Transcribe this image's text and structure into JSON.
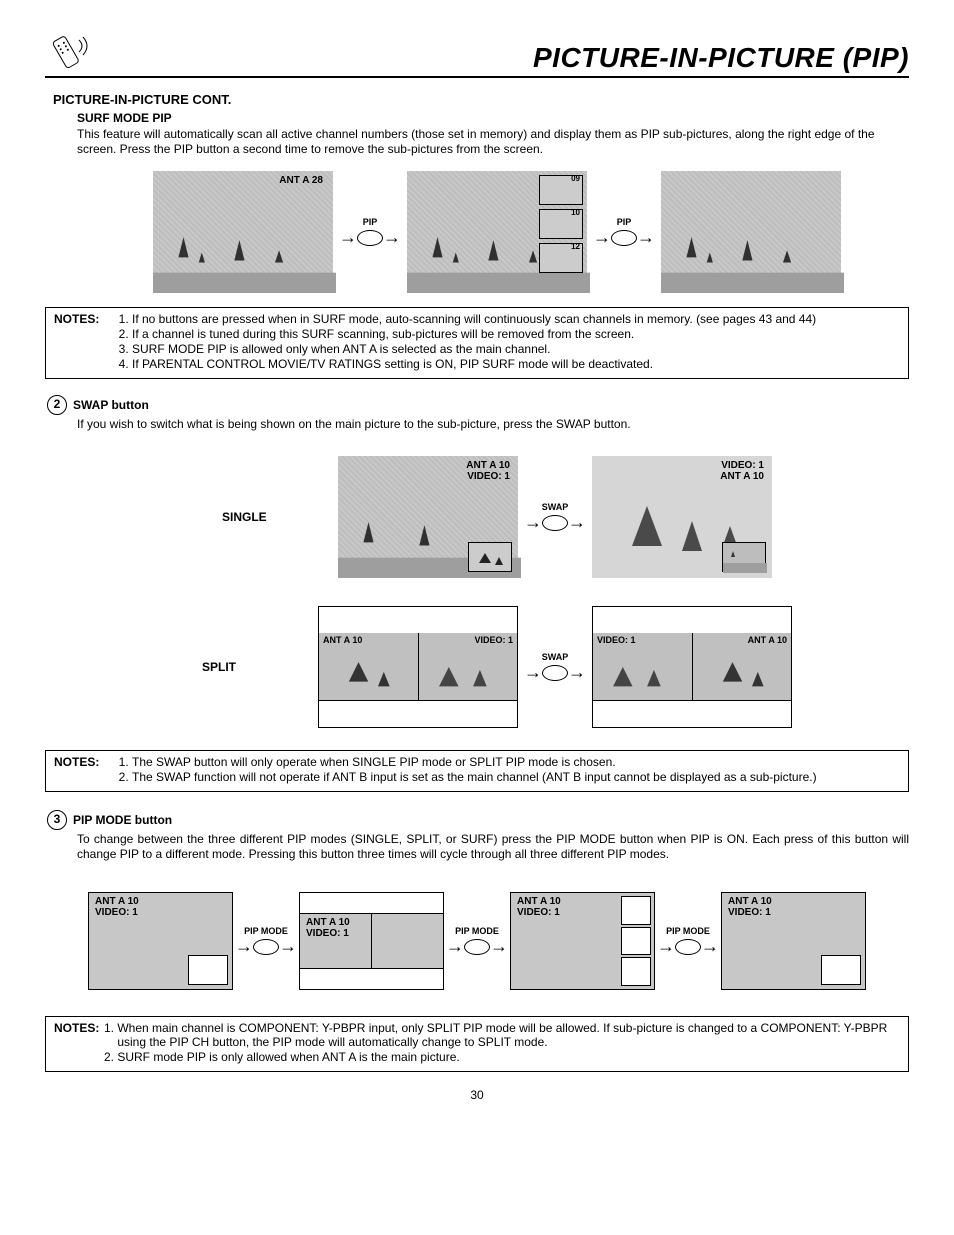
{
  "header": {
    "title": "PICTURE-IN-PICTURE (PIP)"
  },
  "section_cont": "PICTURE-IN-PICTURE CONT.",
  "surf": {
    "title": "SURF MODE PIP",
    "body": "This feature will automatically scan all active channel numbers (those set in memory) and display them as PIP sub-pictures, along the right edge of the screen.  Press the PIP button a second time to remove the sub-pictures from the screen.",
    "tv1_label": "ANT A   28",
    "sub_labels": [
      "09",
      "10",
      "12"
    ],
    "btn": "PIP"
  },
  "notes1": {
    "label": "NOTES:",
    "items": [
      "If no buttons are pressed when in SURF mode, auto-scanning will continuously scan channels in memory.  (see pages 43 and 44)",
      "If a channel is tuned during this SURF scanning, sub-pictures will be removed from the screen.",
      "SURF MODE PIP is allowed only when ANT A is selected as the main channel.",
      "If PARENTAL CONTROL MOVIE/TV RATINGS setting is ON, PIP SURF mode will be deactivated."
    ]
  },
  "swap": {
    "num": "2",
    "title": "SWAP button",
    "body": "If you wish to switch what is being shown on the main picture to the sub-picture, press the SWAP button.",
    "single_label": "SINGLE",
    "split_label": "SPLIT",
    "btn": "SWAP",
    "tv_a": {
      "l1": "ANT A 10",
      "l2": "VIDEO: 1"
    },
    "tv_b": {
      "l1": "VIDEO: 1",
      "l2": "ANT  A 10"
    },
    "split_a": {
      "left": "ANT  A 10",
      "right": "VIDEO: 1"
    },
    "split_b": {
      "left": "VIDEO: 1",
      "right": "ANT  A 10"
    }
  },
  "notes2": {
    "label": "NOTES:",
    "items": [
      "The SWAP button will only operate when SINGLE PIP mode or SPLIT PIP mode is chosen.",
      "The SWAP function will not operate if ANT B input is set as the main channel (ANT B input cannot be displayed as a sub-picture.)"
    ]
  },
  "pipmode": {
    "num": "3",
    "title": "PIP MODE button",
    "body": "To change between the three different PIP modes (SINGLE, SPLIT, or SURF) press the PIP MODE button when PIP is ON.  Each press of this button will change PIP to a different mode.  Pressing this button three times will cycle through all three different PIP modes.",
    "btn": "PIP MODE",
    "lab1": "ANT A 10",
    "lab2": "VIDEO: 1"
  },
  "notes3": {
    "label": "NOTES:",
    "items": [
      "When main channel is COMPONENT: Y-PBPR input, only SPLIT PIP mode will be allowed.  If sub-picture is changed to a COMPONENT: Y-PBPR using the PIP CH button, the PIP mode will automatically change to SPLIT mode.",
      "SURF mode PIP is only allowed when ANT A is the main picture."
    ]
  },
  "page_number": "30"
}
